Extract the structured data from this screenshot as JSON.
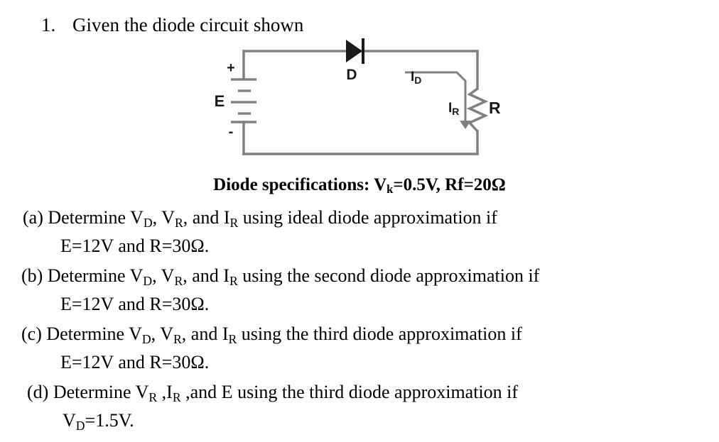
{
  "document": {
    "question_number": "1.",
    "question_text": "Given the diode circuit shown"
  },
  "circuit": {
    "labels": {
      "source": "E",
      "source_plus": "+",
      "source_minus": "-",
      "diode": "D",
      "diode_current": "I",
      "diode_current_sub": "D",
      "resistor_current": "I",
      "resistor_current_sub": "R",
      "resistor": "R"
    },
    "colors": {
      "wire": "#808080",
      "symbol": "#1a1a1a",
      "label": "#1a1a1a"
    }
  },
  "specifications": {
    "prefix": "Diode specifications: ",
    "vk_symbol": "V",
    "vk_sub": "k",
    "vk_value": "=0.5V, ",
    "rf_label": "Rf",
    "rf_value": "=20Ω"
  },
  "parts": [
    {
      "key": "a",
      "marker": "(a) ",
      "l1_pre": "Determine V",
      "l1_s1": "D",
      "l1_mid1": ", V",
      "l1_s2": "R",
      "l1_mid2": ", and I",
      "l1_s3": "R",
      "l1_post": " using ideal diode approximation if",
      "l2": "E=12V and R=30Ω."
    },
    {
      "key": "b",
      "marker": "(b) ",
      "l1_pre": "Determine V",
      "l1_s1": "D",
      "l1_mid1": ", V",
      "l1_s2": "R",
      "l1_mid2": ", and I",
      "l1_s3": "R",
      "l1_post": " using the second diode approximation if",
      "l2": "E=12V and R=30Ω."
    },
    {
      "key": "c",
      "marker": "(c) ",
      "l1_pre": "Determine V",
      "l1_s1": "D",
      "l1_mid1": ", V",
      "l1_s2": "R",
      "l1_mid2": ", and I",
      "l1_s3": "R",
      "l1_post": " using the third diode approximation if",
      "l2": "E=12V and R=30Ω."
    },
    {
      "key": "d",
      "marker": "(d) ",
      "l1_pre": "Determine V",
      "l1_s1": "R",
      "l1_mid1": " ,I",
      "l1_s2": "R",
      "l1_mid2": " ,and E",
      "l1_s3": "",
      "l1_post": " using the third diode approximation if",
      "l2_pre": "V",
      "l2_sub": "D",
      "l2_post": "=1.5V."
    }
  ]
}
